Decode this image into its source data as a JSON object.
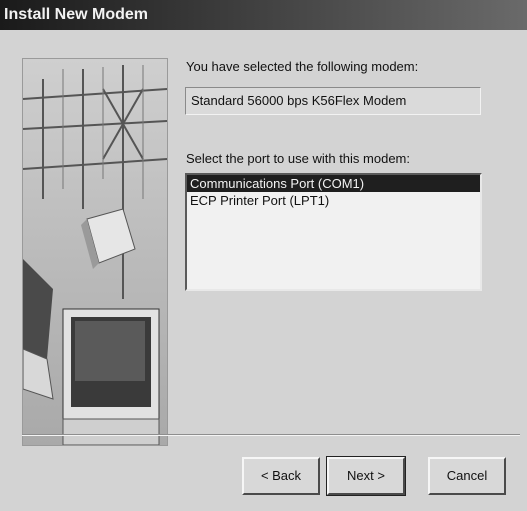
{
  "window": {
    "title": "Install New Modem"
  },
  "main": {
    "selected_label": "You have selected the following modem:",
    "modem_name": "Standard 56000 bps K56Flex Modem",
    "port_label": "Select the port to use with this modem:",
    "ports": [
      {
        "label": "Communications Port (COM1)",
        "selected": true
      },
      {
        "label": "ECP Printer Port (LPT1)",
        "selected": false
      }
    ]
  },
  "buttons": {
    "back": "< Back",
    "next": "Next >",
    "cancel": "Cancel"
  }
}
